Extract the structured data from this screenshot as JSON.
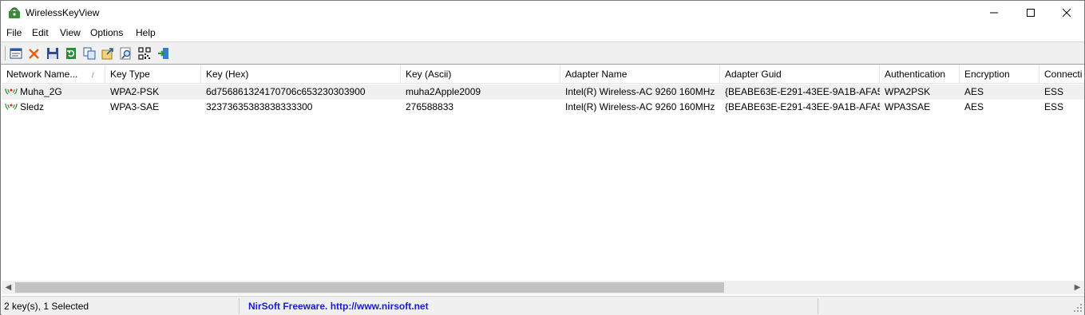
{
  "window": {
    "title": "WirelessKeyView"
  },
  "menu": {
    "items": [
      "File",
      "Edit",
      "View",
      "Options",
      "Help"
    ]
  },
  "toolbar": {
    "buttons": [
      "properties-icon",
      "delete-icon",
      "save-icon",
      "refresh-icon",
      "copy-icon",
      "export-icon",
      "find-icon",
      "qr-code-icon",
      "exit-icon"
    ]
  },
  "columns": [
    "Network Name...",
    "Key Type",
    "Key (Hex)",
    "Key (Ascii)",
    "Adapter Name",
    "Adapter Guid",
    "Authentication",
    "Encryption",
    "Connecti"
  ],
  "sort_indicator": "/",
  "rows": [
    {
      "network": "Muha_2G",
      "key_type": "WPA2-PSK",
      "key_hex": "6d756861324170706c653230303900",
      "key_ascii": "muha2Apple2009",
      "adapter": "Intel(R) Wireless-AC 9260 160MHz",
      "guid": "{BEABE63E-E291-43EE-9A1B-AFA5...",
      "auth": "WPA2PSK",
      "encryption": "AES",
      "connection": "ESS",
      "selected": true
    },
    {
      "network": "Sledz",
      "key_type": "WPA3-SAE",
      "key_hex": "32373635383838333300",
      "key_ascii": "276588833",
      "adapter": "Intel(R) Wireless-AC 9260 160MHz",
      "guid": "{BEABE63E-E291-43EE-9A1B-AFA5...",
      "auth": "WPA3SAE",
      "encryption": "AES",
      "connection": "ESS",
      "selected": false
    }
  ],
  "status": {
    "count": "2 key(s), 1 Selected",
    "credit": "NirSoft Freeware.  http://www.nirsoft.net"
  },
  "colors": {
    "link": "#1b1bd0",
    "selected_row": "#f0f0f0",
    "toolbar": "#f0f0f0"
  }
}
